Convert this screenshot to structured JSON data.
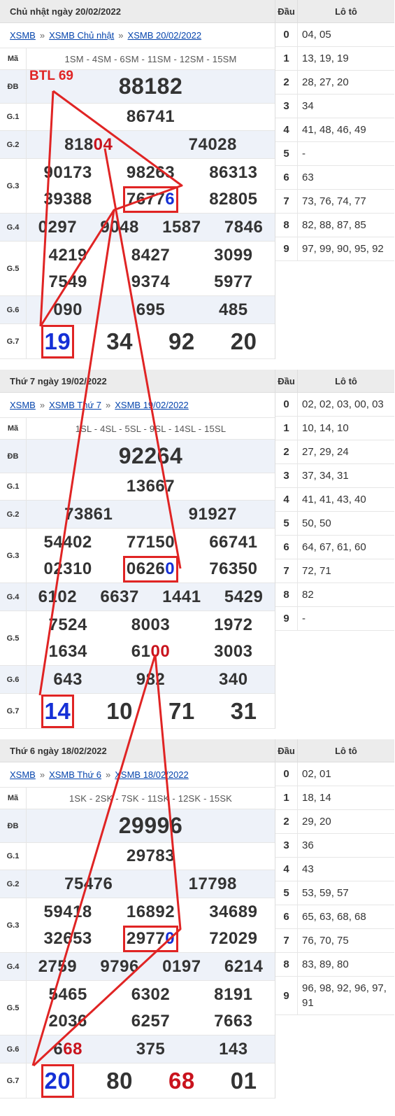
{
  "annotation": {
    "btl": "BTL 69"
  },
  "draws": [
    {
      "title": "Chủ nhật ngày 20/02/2022",
      "crumbs": [
        "XSMB",
        "XSMB Chủ nhật",
        "XSMB 20/02/2022"
      ],
      "ma_label": "Mã",
      "codes": "1SM - 4SM - 6SM - 11SM - 12SM - 15SM",
      "labels": {
        "db": "ĐB",
        "g1": "G.1",
        "g2": "G.2",
        "g3": "G.3",
        "g4": "G.4",
        "g5": "G.5",
        "g6": "G.6",
        "g7": "G.7"
      },
      "db": "88182",
      "g1": "86741",
      "g2": [
        "818",
        "04",
        "74028"
      ],
      "g3": [
        [
          "90173",
          "98263",
          "86313"
        ],
        [
          "39388",
          "7677",
          "6",
          "82805"
        ]
      ],
      "g4": [
        "0297",
        "9048",
        "1587",
        "7846"
      ],
      "g5": [
        [
          "4219",
          "8427",
          "3099"
        ],
        [
          "7549",
          "9374",
          "5977"
        ]
      ],
      "g6": [
        "090",
        "695",
        "485"
      ],
      "g7": [
        "19",
        "34",
        "92",
        "20"
      ],
      "loto_header": {
        "dau": "Đầu",
        "loto": "Lô tô"
      },
      "loto": [
        {
          "d": "0",
          "v": "04, 05"
        },
        {
          "d": "1",
          "v": "13, 19, 19"
        },
        {
          "d": "2",
          "v": "28, 27, 20"
        },
        {
          "d": "3",
          "v": "34"
        },
        {
          "d": "4",
          "v": "41, 48, 46, 49"
        },
        {
          "d": "5",
          "v": "-"
        },
        {
          "d": "6",
          "v": "63"
        },
        {
          "d": "7",
          "v": "73, 76, 74, 77"
        },
        {
          "d": "8",
          "v": "82, 88, 87, 85"
        },
        {
          "d": "9",
          "v": "97, 99, 90, 95, 92"
        }
      ]
    },
    {
      "title": "Thứ 7 ngày 19/02/2022",
      "crumbs": [
        "XSMB",
        "XSMB Thứ 7",
        "XSMB 19/02/2022"
      ],
      "ma_label": "Mã",
      "codes": "1SL - 4SL - 5SL - 9SL - 14SL - 15SL",
      "labels": {
        "db": "ĐB",
        "g1": "G.1",
        "g2": "G.2",
        "g3": "G.3",
        "g4": "G.4",
        "g5": "G.5",
        "g6": "G.6",
        "g7": "G.7"
      },
      "db": "92264",
      "g1": "13667",
      "g2": [
        "73861",
        "",
        "91927"
      ],
      "g3": [
        [
          "54402",
          "77150",
          "66741"
        ],
        [
          "02310",
          "0626",
          "0",
          "76350"
        ]
      ],
      "g4": [
        "6102",
        "6637",
        "1441",
        "5429"
      ],
      "g5": [
        [
          "7524",
          "8003",
          "1972"
        ],
        [
          "1634",
          "61",
          "00",
          "3003"
        ]
      ],
      "g6": [
        "643",
        "982",
        "340"
      ],
      "g7": [
        "14",
        "10",
        "71",
        "31"
      ],
      "loto_header": {
        "dau": "Đầu",
        "loto": "Lô tô"
      },
      "loto": [
        {
          "d": "0",
          "v": "02, 02, 03, 00, 03"
        },
        {
          "d": "1",
          "v": "10, 14, 10"
        },
        {
          "d": "2",
          "v": "27, 29, 24"
        },
        {
          "d": "3",
          "v": "37, 34, 31"
        },
        {
          "d": "4",
          "v": "41, 41, 43, 40"
        },
        {
          "d": "5",
          "v": "50, 50"
        },
        {
          "d": "6",
          "v": "64, 67, 61, 60"
        },
        {
          "d": "7",
          "v": "72, 71"
        },
        {
          "d": "8",
          "v": "82"
        },
        {
          "d": "9",
          "v": "-"
        }
      ]
    },
    {
      "title": "Thứ 6 ngày 18/02/2022",
      "crumbs": [
        "XSMB",
        "XSMB Thứ 6",
        "XSMB 18/02/2022"
      ],
      "ma_label": "Mã",
      "codes": "1SK - 2SK - 7SK - 11SK - 12SK - 15SK",
      "labels": {
        "db": "ĐB",
        "g1": "G.1",
        "g2": "G.2",
        "g3": "G.3",
        "g4": "G.4",
        "g5": "G.5",
        "g6": "G.6",
        "g7": "G.7"
      },
      "db": "29996",
      "g1": "29783",
      "g2": [
        "75476",
        "",
        "17798"
      ],
      "g3": [
        [
          "59418",
          "16892",
          "34689"
        ],
        [
          "32653",
          "2977",
          "0",
          "72029"
        ]
      ],
      "g4": [
        "2759",
        "9796",
        "0197",
        "6214"
      ],
      "g5": [
        [
          "5465",
          "6302",
          "8191"
        ],
        [
          "2036",
          "6257",
          "7663"
        ]
      ],
      "g6": [
        "6",
        "68",
        "375",
        "143"
      ],
      "g7": [
        "20",
        "80",
        "68",
        "01"
      ],
      "loto_header": {
        "dau": "Đầu",
        "loto": "Lô tô"
      },
      "loto": [
        {
          "d": "0",
          "v": "02, 01"
        },
        {
          "d": "1",
          "v": "18, 14"
        },
        {
          "d": "2",
          "v": "29, 20"
        },
        {
          "d": "3",
          "v": "36"
        },
        {
          "d": "4",
          "v": "43"
        },
        {
          "d": "5",
          "v": "53, 59, 57"
        },
        {
          "d": "6",
          "v": "65, 63, 68, 68"
        },
        {
          "d": "7",
          "v": "76, 70, 75"
        },
        {
          "d": "8",
          "v": "83, 89, 80"
        },
        {
          "d": "9",
          "v": "96, 98, 92, 96, 97, 91"
        }
      ]
    }
  ]
}
